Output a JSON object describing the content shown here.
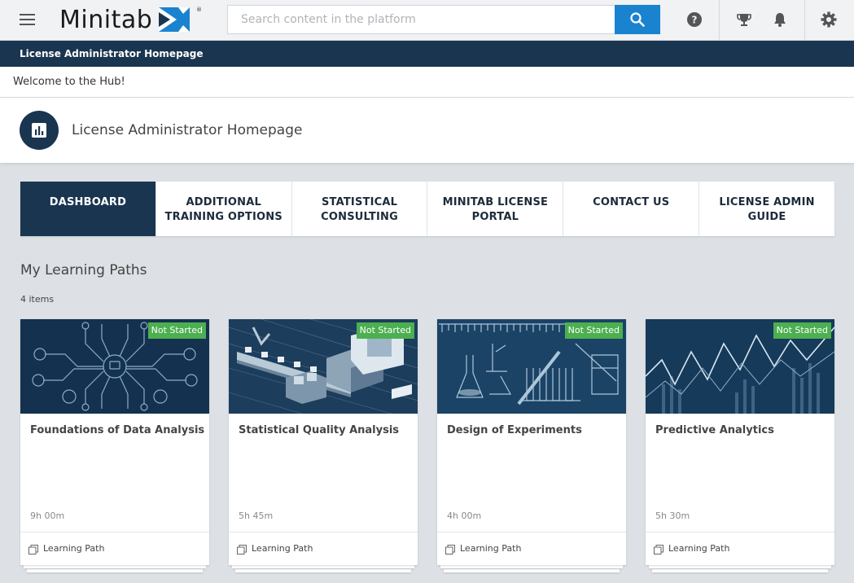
{
  "header": {
    "logo_text": "Minitab",
    "search_placeholder": "Search content in the platform",
    "icons": [
      "menu-icon",
      "search-icon",
      "help-icon",
      "trophy-icon",
      "bell-icon",
      "gear-icon"
    ]
  },
  "band": {
    "title": "License Administrator Homepage"
  },
  "welcome": {
    "text": "Welcome to the Hub!"
  },
  "page": {
    "title": "License Administrator Homepage",
    "avatar_icon": "bar-chart-icon"
  },
  "tabs": [
    {
      "label": "DASHBOARD",
      "active": true
    },
    {
      "label": "ADDITIONAL TRAINING OPTIONS",
      "active": false
    },
    {
      "label": "STATISTICAL CONSULTING",
      "active": false
    },
    {
      "label": "MINITAB LICENSE PORTAL",
      "active": false
    },
    {
      "label": "CONTACT US",
      "active": false
    },
    {
      "label": "LICENSE ADMIN GUIDE",
      "active": false
    }
  ],
  "section": {
    "title": "My Learning Paths",
    "count": "4 items"
  },
  "cards": [
    {
      "title": "Foundations of Data Analysis",
      "status": "Not Started",
      "duration": "9h 00m",
      "type": "Learning Path"
    },
    {
      "title": "Statistical Quality Analysis",
      "status": "Not Started",
      "duration": "5h 45m",
      "type": "Learning Path"
    },
    {
      "title": "Design of Experiments",
      "status": "Not Started",
      "duration": "4h 00m",
      "type": "Learning Path"
    },
    {
      "title": "Predictive Analytics",
      "status": "Not Started",
      "duration": "5h 30m",
      "type": "Learning Path"
    }
  ],
  "colors": {
    "navy": "#1a3550",
    "search_blue": "#1a83cf",
    "badge_green": "#4caf50",
    "background": "#dde1e5"
  }
}
